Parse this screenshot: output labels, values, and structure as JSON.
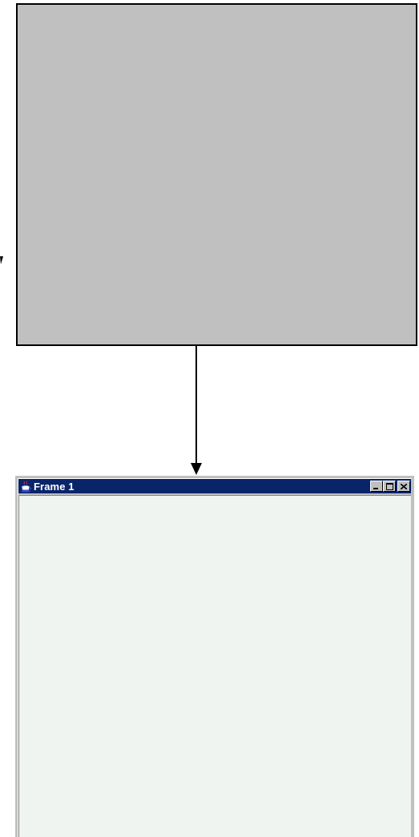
{
  "window": {
    "title": "Frame 1",
    "icon": "java-cup-icon",
    "title_bar_color": "#0a246a",
    "content_color": "#eff4f0",
    "buttons": [
      "minimize",
      "maximize",
      "close"
    ]
  },
  "panel": {
    "fill_color": "#c0c0c0",
    "border_color": "#000000"
  },
  "connector": {
    "direction": "down",
    "from": "panel",
    "to": "window"
  }
}
